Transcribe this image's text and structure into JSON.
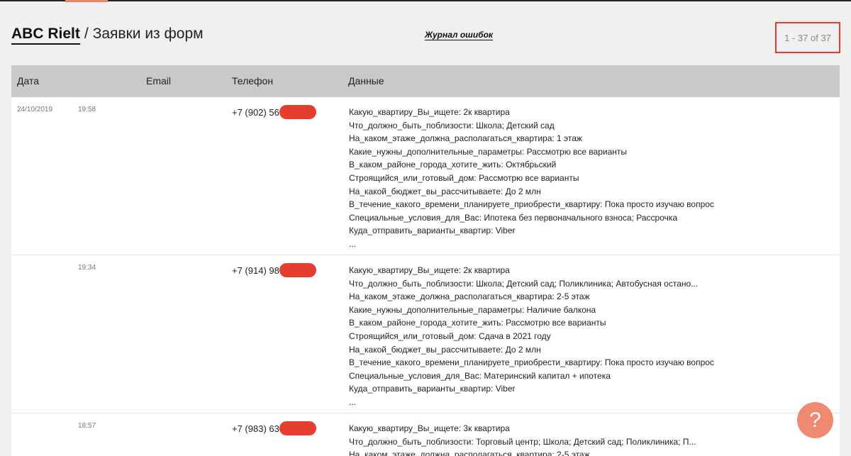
{
  "header": {
    "brand": "ABC Rielt",
    "separator": "/",
    "page_title": "Заявки из форм",
    "errors_link": "Журнал ошибок",
    "pager": "1 - 37 of 37"
  },
  "table": {
    "columns": [
      "Дата",
      "Email",
      "Телефон",
      "Данные"
    ],
    "rows": [
      {
        "date": "24/10/2019",
        "time": "19:58",
        "email": "",
        "phone": "+7 (902) 56",
        "data": [
          "Какую_квартиру_Вы_ищете: 2к квартира",
          "Что_должно_быть_поблизости: Школа; Детский сад",
          "На_каком_этаже_должна_располагаться_квартира: 1 этаж",
          "Какие_нужны_дополнительные_параметры: Рассмотрю все варианты",
          "В_каком_районе_города_хотите_жить: Октябрьский",
          "Строящийся_или_готовый_дом: Рассмотрю все варианты",
          "На_какой_бюджет_вы_рассчитываете: До 2 млн",
          "В_течение_какого_времени_планируете_приобрести_квартиру: Пока просто изучаю вопрос",
          "Специальные_условия_для_Вас: Ипотека без первоначального взноса; Рассрочка",
          "Куда_отправить_варианты_квартир: Viber",
          "..."
        ]
      },
      {
        "date": "",
        "time": "19:34",
        "email": "",
        "phone": "+7 (914) 98",
        "data": [
          "Какую_квартиру_Вы_ищете: 2к квартира",
          "Что_должно_быть_поблизости: Школа; Детский сад; Поликлиника; Автобусная остано...",
          "На_каком_этаже_должна_располагаться_квартира: 2-5 этаж",
          "Какие_нужны_дополнительные_параметры: Наличие балкона",
          "В_каком_районе_города_хотите_жить: Рассмотрю все варианты",
          "Строящийся_или_готовый_дом: Сдача в 2021 году",
          "На_какой_бюджет_вы_рассчитываете: До 2 млн",
          "В_течение_какого_времени_планируете_приобрести_квартиру: Пока просто изучаю вопрос",
          "Специальные_условия_для_Вас: Материнский капитал + ипотека",
          "Куда_отправить_варианты_квартир: Viber",
          "..."
        ]
      },
      {
        "date": "",
        "time": "18:57",
        "email": "",
        "phone": "+7 (983) 63",
        "data": [
          "Какую_квартиру_Вы_ищете: 3к квартира",
          "Что_должно_быть_поблизости: Торговый центр; Школа; Детский сад; Поликлиника; П...",
          "На_каком_этаже_должна_располагаться_квартира: 2-5 этаж"
        ]
      }
    ]
  },
  "help_button": {
    "label": "?"
  },
  "colors": {
    "accent": "#ee8a70",
    "redaction": "#e53d2f",
    "highlight_border": "#e03b35",
    "table_header": "#c9c9c9"
  }
}
